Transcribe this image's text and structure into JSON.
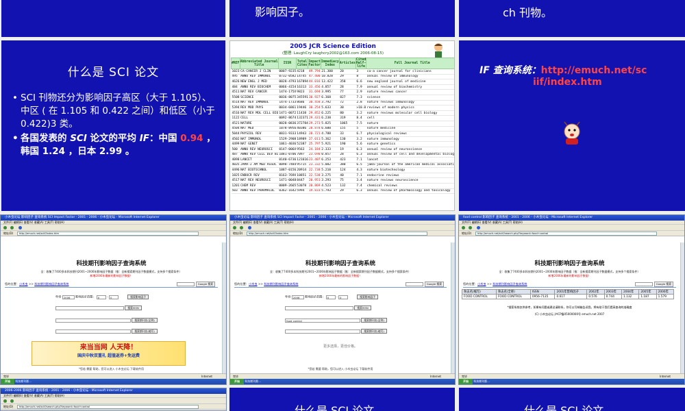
{
  "top_tiles": {
    "t2_text": "影响因子。",
    "t3_text": "ch 刊物。"
  },
  "slide_sci": {
    "title": "什么是 SCI  论文",
    "bullet1": "SCI 刊物还分为影响因子高区（大于 1.105）、中区 ( 在 1.105 和 0.422 之间）和低区（小于 0.422)3 类。",
    "bullet2_pre": "各国发表的 ",
    "bullet2_sci": "SCI",
    "bullet2_mid": " 论文的平均 ",
    "bullet2_if": "IF",
    "bullet2_post1": "：中国 ",
    "bullet2_china": "0.94",
    "bullet2_post2": " ，韩国 1.24 ，日本 2.99 。"
  },
  "jcr": {
    "title": "2005 JCR Science Edition",
    "subtitle": "(整理: LaughCry laughcry2002@163.com  2006-08-15)",
    "headers": [
      "#REF",
      "Abbreviated Journal Title",
      "ISSN",
      "Total Cites",
      "Impact Factor",
      "Immediacy Index",
      "Articles",
      "Cited Half-life",
      "Full Journal Title"
    ],
    "rows": [
      [
        "1023",
        "CA-CANCER J CLIN",
        "0007-9235",
        "4218",
        "49.794",
        "21.300",
        "20",
        "3",
        "ca-a cancer journal for clinicians"
      ],
      [
        "495",
        "ANNU REV IMMUNOL",
        "0732-0582",
        "14745",
        "47.400",
        "10.828",
        "29",
        "8",
        "annual review of immunology"
      ],
      [
        "4626",
        "NEW ENGL J MED",
        "0028-4793",
        "167894",
        "44.016",
        "13.422",
        "358",
        "6.6",
        "new england journal of medicine"
      ],
      [
        "484",
        "ANNU REV BIOCHEM",
        "0066-4154",
        "16313",
        "33.456",
        "4.857",
        "28",
        "7.9",
        "annual review of biochemistry"
      ],
      [
        "4511",
        "NAT REV CANCER",
        "1474-175X",
        "9823",
        "31.694",
        "3.995",
        "77",
        "2.9",
        "nature reviews cancer"
      ],
      [
        "5508",
        "SCIENCE",
        "0036-8075",
        "345591",
        "30.927",
        "6.368",
        "827",
        "7.3",
        "science"
      ],
      [
        "4514",
        "NAT REV IMMUNOL",
        "1474-1733",
        "8686",
        "30.458",
        "3.792",
        "72",
        "2.8",
        "nature reviews immunology"
      ],
      [
        "5394",
        "REV MOD PHYS",
        "0034-6861",
        "19446",
        "30.254",
        "5.633",
        "30",
        ">10.0",
        "reviews of modern physics"
      ],
      [
        "4516",
        "NAT REV MOL CELL BIO",
        "1471-0072",
        "11438",
        "29.852",
        "6.225",
        "80",
        "3.2",
        "nature reviews molecular cell biology"
      ],
      [
        "1122",
        "CELL",
        "0092-8674",
        "132371",
        "29.431",
        "6.238",
        "319",
        "8.4",
        "cell"
      ],
      [
        "4521",
        "NATURE",
        "0028-0836",
        "372784",
        "29.273",
        "5.825",
        "1065",
        "7.5",
        "nature"
      ],
      [
        "4504",
        "NAT MED",
        "1078-8956",
        "40386",
        "28.878",
        "6.600",
        "155",
        "5",
        "nature medicine"
      ],
      [
        "5044",
        "PHYSIOL REV",
        "0031-9333",
        "14943",
        "28.721",
        "4.788",
        "33",
        "6.7",
        "physiological reviews"
      ],
      [
        "4502",
        "NAT IMMUNOL",
        "1529-2908",
        "18989",
        "27.011",
        "5.362",
        "130",
        "3.2",
        "nature immunology"
      ],
      [
        "4499",
        "NAT GENET",
        "1061-4036",
        "52387",
        "25.797",
        "5.921",
        "190",
        "5.6",
        "nature genetics"
      ],
      [
        "500",
        "ANNU REV NEUROSCI",
        "0147-006X",
        "9563",
        "24.184",
        "2.333",
        "19",
        "6.3",
        "annual review of neuroscience"
      ],
      [
        "487",
        "ANNU REV CELL DEV BI",
        "1081-0706",
        "7097",
        "23.690",
        "0.857",
        "28",
        "6.3",
        "annual review of cell and developmental biology"
      ],
      [
        "4098",
        "LANCET",
        "0140-6736",
        "121616",
        "23.407",
        "6.253",
        "423",
        "7.1",
        "lancet"
      ],
      [
        "4035",
        "JAMA-J AM MED ASSOC",
        "0098-7484",
        "95715",
        "23.332",
        "5.082",
        "380",
        "6.5",
        "jama-journal of the american medical association"
      ],
      [
        "4496",
        "NAT BIOTECHNOL",
        "1087-0156",
        "20914",
        "22.738",
        "5.210",
        "124",
        "4.3",
        "nature biotechnology"
      ],
      [
        "1825",
        "ENDOCR REV",
        "0163-769X",
        "10851",
        "22.538",
        "3.275",
        "40",
        "7.1",
        "endocrine reviews"
      ],
      [
        "4517",
        "NAT REV NEUROSCI",
        "1471-0048",
        "8447",
        "20.951",
        "3.293",
        "75",
        "3.4",
        "nature reviews neuroscience"
      ],
      [
        "1201",
        "CHEM REV",
        "0009-2665",
        "53078",
        "20.869",
        "4.523",
        "132",
        "7.4",
        "chemical reviews"
      ],
      [
        "503",
        "ANNU REV PHARMACOL",
        "0362-1642",
        "5994",
        "19.833",
        "5.793",
        "29",
        "6.3",
        "annual review of pharmacology and toxicology"
      ]
    ]
  },
  "slide_query": {
    "label": "IF 查询系统：",
    "url1": "http://emuch.net/sc",
    "url2": "iif/index.htm"
  },
  "shot1": {
    "window_title": "小木虫论坛 影响因子 查询系统 SCI Impact Factor - 2001 - 2006 - 小木虫论坛 - Microsoft Internet Explorer",
    "menu": "文件(F)  编辑(E)  查看(V)  收藏(A)  工具(T)  帮助(H)",
    "address_label": "地址(D)",
    "address": "http://emuch.net/sciif/index.htm",
    "heading": "科技期刊影响因子查询系统",
    "desc": "全：收集了7400多本科技期刊2001~2006年影响因子数据（推：全新搜索期刊因子数据模式，支持多个搜索条件）",
    "recent": "新增2006年最新的影响因子数据！",
    "location": "您的位置：",
    "loc_link1": "小木虫",
    "loc_link2": "科技期刊影响因子查询系统",
    "google_btn": "Google 搜索",
    "year_label": "年份",
    "year_value": "2006",
    "range_label": "影响因子范围：",
    "range_from": "0",
    "range_to": "0",
    "btn_search_if": "搜索影响因子",
    "btn_search_issn": "搜索ISSN",
    "btn_search_full": "搜索期刊名(全称)",
    "btn_search_abbr": "搜索期刊名(缩写)",
    "banner_text": "来当当网 人天降！",
    "banner_sub": "国庆中秋双重礼 超值返券+免运费",
    "footer": "*您若 需要 帮助，您可以进入 小木虫论坛 下载软件用",
    "status": "完毕",
    "status_right": "Internet",
    "taskbar_start": "开始",
    "taskbar_item": "科技期刊影..."
  },
  "shot2": {
    "window_title": "小木虫论坛 影响因子 查询系统 SCI Impact Factor - 2001 - 2006 - 小木虫论坛 - Microsoft Internet Explorer",
    "address": "http://emuch.net/sciif/index.htm",
    "heading": "科技期刊影响因子查询系统",
    "search_text": "food control",
    "more_text": "更多选择，更佳价格。",
    "footer": "*您若 需要 帮助，您可以进入 小木虫论坛 下载软件用"
  },
  "shot3": {
    "window_title": "food control 影响因子 查询系统 - 2001 - 2006 - 小木虫论坛 - Microsoft Internet Explorer",
    "address": "http://emuch.net/sciif/search.php?keyword=food+control",
    "heading": "科技期刊影响因子查询系统",
    "table_headers": [
      "杂志名(缩写)",
      "杂志名(全称)",
      "ISSN",
      "2001年影响因子",
      "2002年",
      "2003年",
      "2004年",
      "2005年",
      "2006年"
    ],
    "table_row": [
      "FOOD CONTROL",
      "FOOD CONTROL",
      "0956-7135",
      "0.617",
      "0.576",
      "0.744",
      "1.132",
      "1.187",
      "1.579"
    ],
    "note": "*搜索系统仅供参考，如果有问题或建议请联系，你可以写邮箱告诉我，将有助于我们提高查询的准确度",
    "copy": "(C) 小木虫论坛 沪ICP备05000000号 emuch.net 2007"
  },
  "bottom": {
    "b2_text": "什么是 SCI  论文",
    "b3_text": "什么是 SCI  论文",
    "b1_title": "2006-2006 影响因子 查询系统 - 2001 - 2006 - 小木虫论坛 - Microsoft Internet Explorer"
  }
}
